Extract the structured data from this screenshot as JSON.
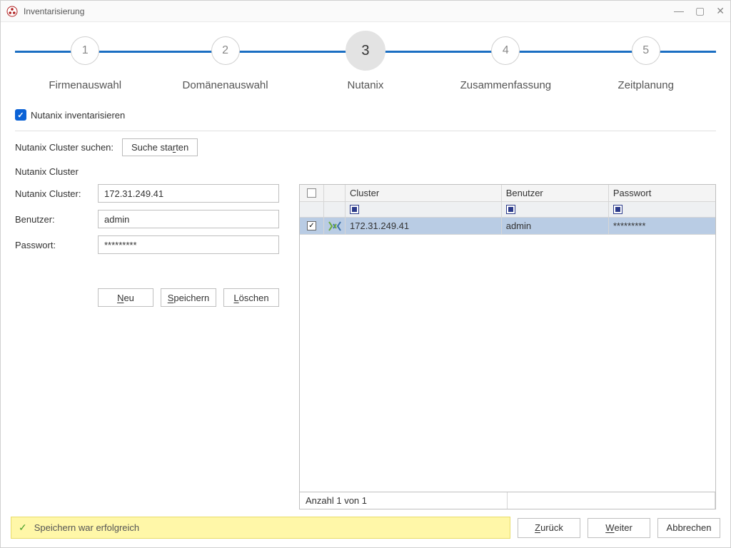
{
  "window": {
    "title": "Inventarisierung"
  },
  "stepper": {
    "steps": [
      {
        "num": "1",
        "label": "Firmenauswahl"
      },
      {
        "num": "2",
        "label": "Domänenauswahl"
      },
      {
        "num": "3",
        "label": "Nutanix"
      },
      {
        "num": "4",
        "label": "Zusammenfassung"
      },
      {
        "num": "5",
        "label": "Zeitplanung"
      }
    ],
    "active_index": 2
  },
  "checkbox_label": "Nutanix inventarisieren",
  "search": {
    "label": "Nutanix Cluster suchen:",
    "button_prefix": "Suche sta",
    "button_u": "r",
    "button_suffix": "ten"
  },
  "section_title": "Nutanix Cluster",
  "form": {
    "cluster_label": "Nutanix Cluster:",
    "cluster_value": "172.31.249.41",
    "user_label": "Benutzer:",
    "user_value": "admin",
    "pass_label": "Passwort:",
    "pass_value": "*********"
  },
  "buttons": {
    "neu_u": "N",
    "neu_suffix": "eu",
    "speichern_u": "S",
    "speichern_suffix": "peichern",
    "loeschen_u": "L",
    "loeschen_suffix": "öschen"
  },
  "grid": {
    "headers": {
      "cluster": "Cluster",
      "user": "Benutzer",
      "pass": "Passwort"
    },
    "rows": [
      {
        "cluster": "172.31.249.41",
        "user": "admin",
        "pass": "*********",
        "checked": true
      }
    ],
    "footer": "Anzahl 1 von 1"
  },
  "status": {
    "text": "Speichern war erfolgreich"
  },
  "nav": {
    "back_u": "Z",
    "back_suffix": "urück",
    "next_u": "W",
    "next_suffix": "eiter",
    "cancel": "Abbrechen"
  }
}
